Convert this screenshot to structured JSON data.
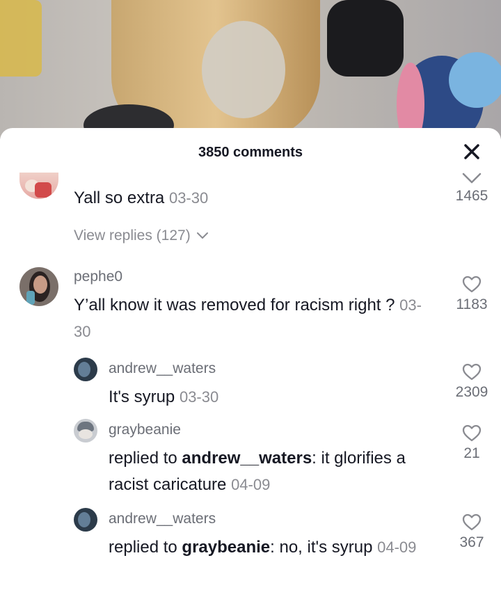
{
  "header": {
    "comment_count": "3850 comments"
  },
  "comments": [
    {
      "text": "Yall so extra",
      "date": "03-30",
      "likes": "1465",
      "view_replies": "View replies (127)"
    },
    {
      "username": "pephe0",
      "text": "Y’all know it was removed for racism right ?",
      "date": "03-30",
      "likes": "1183"
    }
  ],
  "replies": [
    {
      "username": "andrew__waters",
      "text": "It's syrup",
      "date": "03-30",
      "likes": "2309"
    },
    {
      "username": "graybeanie",
      "prefix": "replied to ",
      "mention": "andrew__waters",
      "text": ": it glorifies a racist caricature",
      "date": "04-09",
      "likes": "21"
    },
    {
      "username": "andrew__waters",
      "prefix": "replied to ",
      "mention": "graybeanie",
      "text": ": no, it's syrup",
      "date": "04-09",
      "likes": "367"
    }
  ],
  "icons": {
    "close": "close-icon",
    "like": "heart-icon",
    "expand": "chevron-down-icon"
  },
  "colors": {
    "text": "#161823",
    "secondary": "#8a8b91"
  }
}
